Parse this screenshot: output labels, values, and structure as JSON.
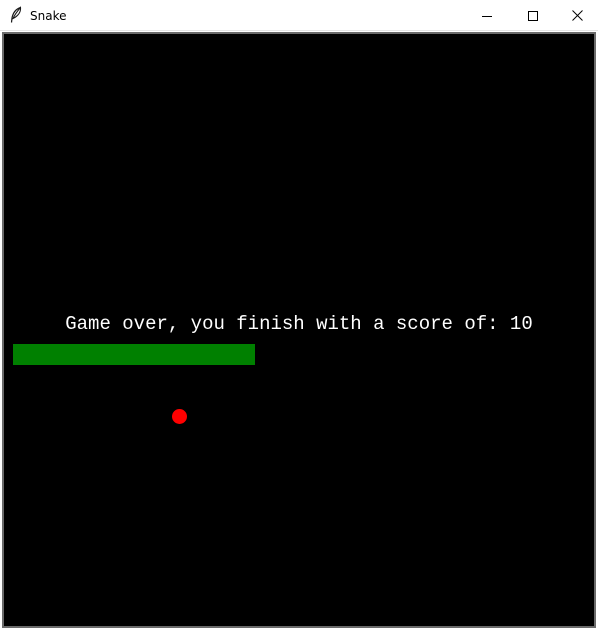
{
  "window": {
    "title": "Snake",
    "icon": "feather-icon"
  },
  "controls": {
    "minimize_icon": "minimize-icon",
    "maximize_icon": "maximize-icon",
    "close_icon": "close-icon"
  },
  "game": {
    "message": "Game over, you finish with a score of: 10",
    "background_color": "#000000",
    "text_color": "#ffffff",
    "snake_color": "#008000",
    "food_color": "#ff0000"
  }
}
